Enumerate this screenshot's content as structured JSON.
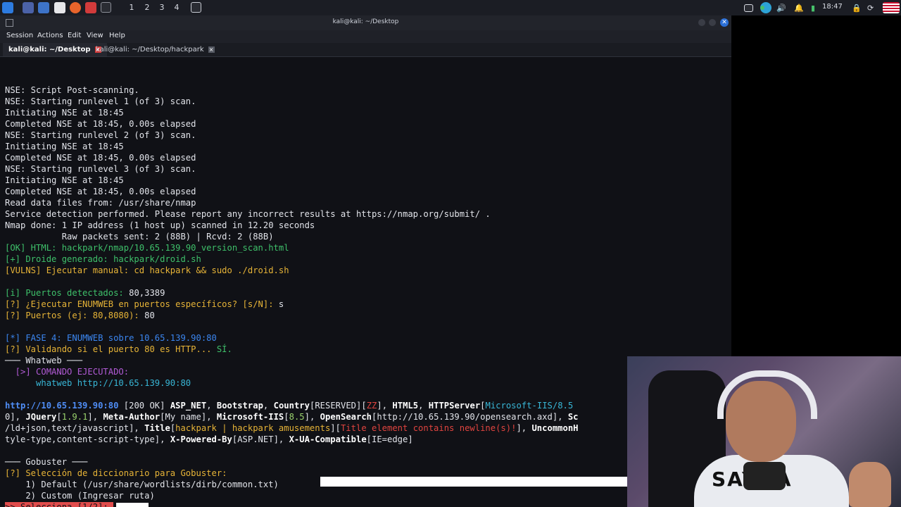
{
  "taskbar": {
    "workspaces": [
      "1",
      "2",
      "3",
      "4"
    ],
    "clock": "18:47",
    "icons": [
      "kali-menu-icon",
      "desktop-icon",
      "folder-icon",
      "text-editor-icon",
      "firefox-icon",
      "burp-icon",
      "terminal-icon",
      "terminal-active-icon"
    ]
  },
  "window": {
    "title": "kali@kali: ~/Desktop",
    "menu": [
      "Session",
      "Actions",
      "Edit",
      "View",
      "Help"
    ],
    "tabs": [
      {
        "label": "kali@kali: ~/Desktop",
        "active": true
      },
      {
        "label": "kali@kali: ~/Desktop/hackpark",
        "active": false
      }
    ]
  },
  "terminal": {
    "lines": [
      [
        {
          "t": "NSE: Script Post-scanning."
        }
      ],
      [
        {
          "t": "NSE: Starting runlevel 1 (of 3) scan."
        }
      ],
      [
        {
          "t": "Initiating NSE at 18:45"
        }
      ],
      [
        {
          "t": "Completed NSE at 18:45, 0.00s elapsed"
        }
      ],
      [
        {
          "t": "NSE: Starting runlevel 2 (of 3) scan."
        }
      ],
      [
        {
          "t": "Initiating NSE at 18:45"
        }
      ],
      [
        {
          "t": "Completed NSE at 18:45, 0.00s elapsed"
        }
      ],
      [
        {
          "t": "NSE: Starting runlevel 3 (of 3) scan."
        }
      ],
      [
        {
          "t": "Initiating NSE at 18:45"
        }
      ],
      [
        {
          "t": "Completed NSE at 18:45, 0.00s elapsed"
        }
      ],
      [
        {
          "t": "Read data files from: /usr/share/nmap"
        }
      ],
      [
        {
          "t": "Service detection performed. Please report any incorrect results at https://nmap.org/submit/ ."
        }
      ],
      [
        {
          "t": "Nmap done: 1 IP address (1 host up) scanned in 12.20 seconds"
        }
      ],
      [
        {
          "t": "           Raw packets sent: 2 (88B) | Rcvd: 2 (88B)"
        }
      ],
      [
        {
          "t": "[OK] HTML: ",
          "c": "g"
        },
        {
          "t": "hackpark/nmap/10.65.139.90_version_scan.html",
          "c": "g"
        }
      ],
      [
        {
          "t": "[+] Droide generado: hackpark/droid.sh",
          "c": "g"
        }
      ],
      [
        {
          "t": "[VULNS] Ejecutar manual: cd hackpark && sudo ./droid.sh",
          "c": "y"
        }
      ],
      [
        {
          "t": ""
        }
      ],
      [
        {
          "t": "[i] Puertos detectados: ",
          "c": "g"
        },
        {
          "t": "80,3389"
        }
      ],
      [
        {
          "t": "[?] ¿Ejecutar ENUMWEB en puertos específicos? [s/N]: ",
          "c": "y"
        },
        {
          "t": "s"
        }
      ],
      [
        {
          "t": "[?] Puertos (ej: 80,8080): ",
          "c": "y"
        },
        {
          "t": "80"
        }
      ],
      [
        {
          "t": ""
        }
      ],
      [
        {
          "t": "[*] FASE 4: ENUMWEB sobre 10.65.139.90:80",
          "c": "b"
        }
      ],
      [
        {
          "t": "[?] Validando si el puerto 80 es HTTP... ",
          "c": "y"
        },
        {
          "t": "SÍ.",
          "c": "g"
        }
      ],
      [
        {
          "t": "─── Whatweb ───"
        }
      ],
      [
        {
          "t": "  [>] COMANDO EJECUTADO:",
          "c": "m"
        }
      ],
      [
        {
          "t": "      whatweb http://10.65.139.90:80",
          "c": "c"
        }
      ],
      [
        {
          "t": ""
        }
      ],
      [
        {
          "t": "http://10.65.139.90:80",
          "c": "u"
        },
        {
          "t": " [200 OK] "
        },
        {
          "t": "ASP_NET",
          "c": "w"
        },
        {
          "t": ", "
        },
        {
          "t": "Bootstrap",
          "c": "w"
        },
        {
          "t": ", "
        },
        {
          "t": "Country",
          "c": "w"
        },
        {
          "t": "[RESERVED]["
        },
        {
          "t": "ZZ",
          "c": "r"
        },
        {
          "t": "], "
        },
        {
          "t": "HTML5",
          "c": "w"
        },
        {
          "t": ", "
        },
        {
          "t": "HTTPServer",
          "c": "w"
        },
        {
          "t": "["
        },
        {
          "t": "Microsoft-IIS/8.5",
          "c": "c"
        }
      ],
      [
        {
          "t": "0], "
        },
        {
          "t": "JQuery",
          "c": "w"
        },
        {
          "t": "["
        },
        {
          "t": "1.9.1",
          "c": "lg"
        },
        {
          "t": "], "
        },
        {
          "t": "Meta-Author",
          "c": "w"
        },
        {
          "t": "[My name], "
        },
        {
          "t": "Microsoft-IIS",
          "c": "w"
        },
        {
          "t": "["
        },
        {
          "t": "8.5",
          "c": "lg"
        },
        {
          "t": "], "
        },
        {
          "t": "OpenSearch",
          "c": "w"
        },
        {
          "t": "[http://10.65.139.90/opensearch.axd], "
        },
        {
          "t": "Sc",
          "c": "w"
        }
      ],
      [
        {
          "t": "/ld+json,text/javascript], "
        },
        {
          "t": "Title",
          "c": "w"
        },
        {
          "t": "["
        },
        {
          "t": "hackpark | hackpark amusements",
          "c": "y"
        },
        {
          "t": "]["
        },
        {
          "t": "Title element contains newline(s)!",
          "c": "r"
        },
        {
          "t": "], "
        },
        {
          "t": "UncommonH",
          "c": "w"
        }
      ],
      [
        {
          "t": "tyle-type,content-script-type], "
        },
        {
          "t": "X-Powered-By",
          "c": "w"
        },
        {
          "t": "[ASP.NET], "
        },
        {
          "t": "X-UA-Compatible",
          "c": "w"
        },
        {
          "t": "[IE=edge]"
        }
      ],
      [
        {
          "t": ""
        }
      ],
      [
        {
          "t": "─── Gobuster ───"
        }
      ],
      [
        {
          "t": "[?] Selección de diccionario para Gobuster:",
          "c": "y"
        }
      ],
      [
        {
          "t": "    1) Default (/usr/share/wordlists/dirb/common.txt)"
        }
      ],
      [
        {
          "t": "    2) Custom (Ingresar ruta)"
        }
      ],
      [
        {
          "t": ">> Selecciona [1/2]: ",
          "c": "prompt"
        }
      ]
    ]
  },
  "webcam": {
    "shirt_text": "SAYNA"
  }
}
